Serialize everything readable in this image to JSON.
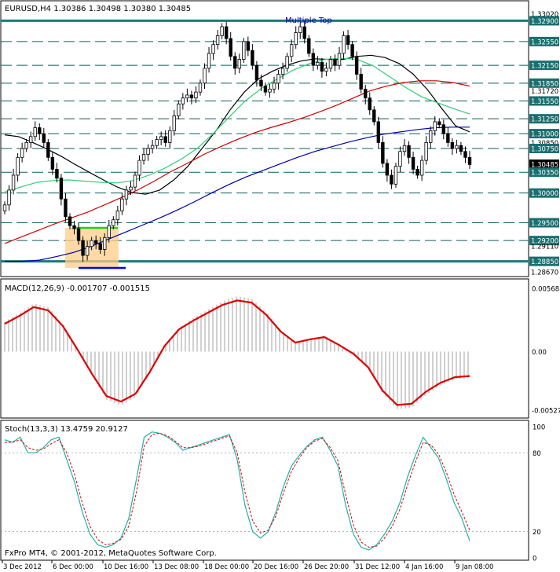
{
  "chart_data": [
    {
      "type": "candlestick",
      "title": "EURUSD,H4  1.30386 1.30498 1.30380 1.30485",
      "annotation": "Multiple Top",
      "ylim": [
        1.2862,
        1.3321
      ],
      "price_labels": [
        "1.33020",
        "1.32900",
        "1.32550",
        "1.32150",
        "1.31850",
        "1.31720",
        "1.31550",
        "1.31250",
        "1.31000",
        "1.30850",
        "1.30750",
        "1.30485",
        "1.30350",
        "1.30000",
        "1.29500",
        "1.29200",
        "1.29110",
        "1.28850",
        "1.28670"
      ],
      "current_price": "1.30485",
      "horizontal_levels": [
        1.329,
        1.3255,
        1.3215,
        1.3185,
        1.3155,
        1.3125,
        1.31,
        1.3075,
        1.3035,
        1.3,
        1.295,
        1.292,
        1.2885
      ],
      "thick_levels": [
        1.329,
        1.2885
      ],
      "closes": [
        1.298,
        1.3005,
        1.303,
        1.306,
        1.3075,
        1.3085,
        1.3095,
        1.311,
        1.31,
        1.3085,
        1.306,
        1.304,
        1.3025,
        1.299,
        1.296,
        1.2945,
        1.294,
        1.292,
        1.2895,
        1.291,
        1.292,
        1.2915,
        1.2905,
        1.2925,
        1.2945,
        1.2955,
        1.297,
        1.299,
        1.3005,
        1.301,
        1.303,
        1.3055,
        1.3065,
        1.3075,
        1.308,
        1.309,
        1.3095,
        1.3085,
        1.3105,
        1.313,
        1.315,
        1.316,
        1.3165,
        1.316,
        1.317,
        1.3185,
        1.321,
        1.3235,
        1.325,
        1.3265,
        1.328,
        1.326,
        1.323,
        1.321,
        1.3225,
        1.3255,
        1.324,
        1.3215,
        1.319,
        1.318,
        1.317,
        1.3175,
        1.3185,
        1.32,
        1.321,
        1.323,
        1.325,
        1.327,
        1.328,
        1.326,
        1.3235,
        1.3215,
        1.322,
        1.3205,
        1.321,
        1.3225,
        1.3215,
        1.3235,
        1.3265,
        1.325,
        1.323,
        1.32,
        1.3175,
        1.316,
        1.314,
        1.312,
        1.3085,
        1.305,
        1.303,
        1.3015,
        1.3045,
        1.307,
        1.308,
        1.306,
        1.304,
        1.303,
        1.3055,
        1.3085,
        1.3105,
        1.312,
        1.3115,
        1.31,
        1.3085,
        1.3075,
        1.308,
        1.307,
        1.306,
        1.3048
      ],
      "moving_averages": [
        {
          "color": "#000000",
          "values": [
            1.3098,
            1.3095,
            1.3085,
            1.3074,
            1.3062,
            1.3048,
            1.3035,
            1.3022,
            1.301,
            1.3001,
            1.2998,
            1.3005,
            1.3022,
            1.3045,
            1.3075,
            1.3105,
            1.314,
            1.317,
            1.3192,
            1.3205,
            1.3215,
            1.3222,
            1.3226,
            1.3225,
            1.3225,
            1.323,
            1.3232,
            1.3228,
            1.3218,
            1.32,
            1.3174,
            1.3143,
            1.3113,
            1.3103
          ]
        },
        {
          "color": "#33cc77",
          "values": [
            1.3002,
            1.301,
            1.3018,
            1.3021,
            1.3022,
            1.302,
            1.3018,
            1.3017,
            1.3021,
            1.303,
            1.3042,
            1.3057,
            1.3075,
            1.31,
            1.3128,
            1.3155,
            1.3176,
            1.3192,
            1.3207,
            1.3218,
            1.3225,
            1.3227,
            1.3225,
            1.3214,
            1.3196,
            1.3178,
            1.3162,
            1.3152,
            1.3142,
            1.3133
          ]
        },
        {
          "color": "#cc0000",
          "values": [
            1.2915,
            1.2926,
            1.2937,
            1.2948,
            1.2958,
            1.2968,
            1.298,
            1.2992,
            1.3005,
            1.302,
            1.3036,
            1.305,
            1.3065,
            1.3078,
            1.309,
            1.3101,
            1.311,
            1.3118,
            1.3127,
            1.3137,
            1.3148,
            1.316,
            1.3172,
            1.318,
            1.3186,
            1.3189,
            1.3189,
            1.3186,
            1.318
          ]
        },
        {
          "color": "#0000aa",
          "values": [
            1.2885,
            1.2885,
            1.2887,
            1.2893,
            1.29,
            1.291,
            1.2922,
            1.2934,
            1.2946,
            1.2958,
            1.2971,
            1.2985,
            1.3,
            1.3014,
            1.3027,
            1.3038,
            1.3049,
            1.306,
            1.307,
            1.3078,
            1.3086,
            1.3093,
            1.3099,
            1.3103,
            1.3107,
            1.311,
            1.3111,
            1.3111
          ]
        }
      ]
    },
    {
      "type": "macd",
      "title": "MACD(12,26,9) -0.001707 -0.001515",
      "ylim": [
        -0.00527,
        0.005685
      ],
      "tick_labels": [
        "0.005685",
        "0.00",
        "-0.00527"
      ],
      "signal": [
        0.0025,
        0.0032,
        0.004,
        0.0037,
        0.0023,
        0.0002,
        -0.002,
        -0.004,
        -0.0045,
        -0.0038,
        -0.0018,
        0.0005,
        0.002,
        0.0028,
        0.0035,
        0.0042,
        0.0046,
        0.0044,
        0.0033,
        0.0018,
        0.0008,
        0.0011,
        0.0013,
        0.0006,
        -0.0002,
        -0.0014,
        -0.0035,
        -0.0048,
        -0.0047,
        -0.0036,
        -0.0028,
        -0.0023,
        -0.0022
      ]
    },
    {
      "type": "stochastic",
      "title": "Stoch(13,3,3) 13.4759 20.9127",
      "ylim": [
        0,
        100
      ],
      "tick_labels": [
        "100",
        "80",
        "20",
        "0"
      ],
      "main": [
        90,
        88,
        92,
        80,
        80,
        84,
        90,
        92,
        75,
        58,
        35,
        18,
        10,
        8,
        10,
        15,
        30,
        60,
        92,
        96,
        95,
        92,
        88,
        82,
        84,
        86,
        88,
        90,
        92,
        94,
        75,
        40,
        20,
        15,
        20,
        35,
        55,
        70,
        78,
        85,
        90,
        92,
        82,
        70,
        40,
        18,
        8,
        6,
        10,
        18,
        28,
        42,
        62,
        78,
        92,
        84,
        76,
        60,
        42,
        30,
        13
      ],
      "signal": [
        88,
        88,
        90,
        84,
        82,
        83,
        87,
        90,
        80,
        64,
        42,
        24,
        14,
        10,
        11,
        14,
        24,
        50,
        85,
        94,
        95,
        93,
        89,
        84,
        84,
        85,
        87,
        89,
        91,
        93,
        80,
        50,
        28,
        19,
        21,
        32,
        50,
        66,
        76,
        84,
        89,
        91,
        84,
        74,
        48,
        25,
        12,
        8,
        9,
        15,
        24,
        37,
        56,
        73,
        88,
        86,
        79,
        65,
        48,
        35,
        21
      ]
    }
  ],
  "date_labels": [
    "3 Dec 2012",
    "6 Dec 00:00",
    "10 Dec 16:00",
    "13 Dec 08:00",
    "18 Dec 00:00",
    "20 Dec 16:00",
    "26 Dec 20:00",
    "31 Dec 12:00",
    "4 Jan 16:00",
    "9 Jan 08:00"
  ],
  "copyright": "FxPro MT4, © 2001-2012, MetaQuotes Software Corp."
}
